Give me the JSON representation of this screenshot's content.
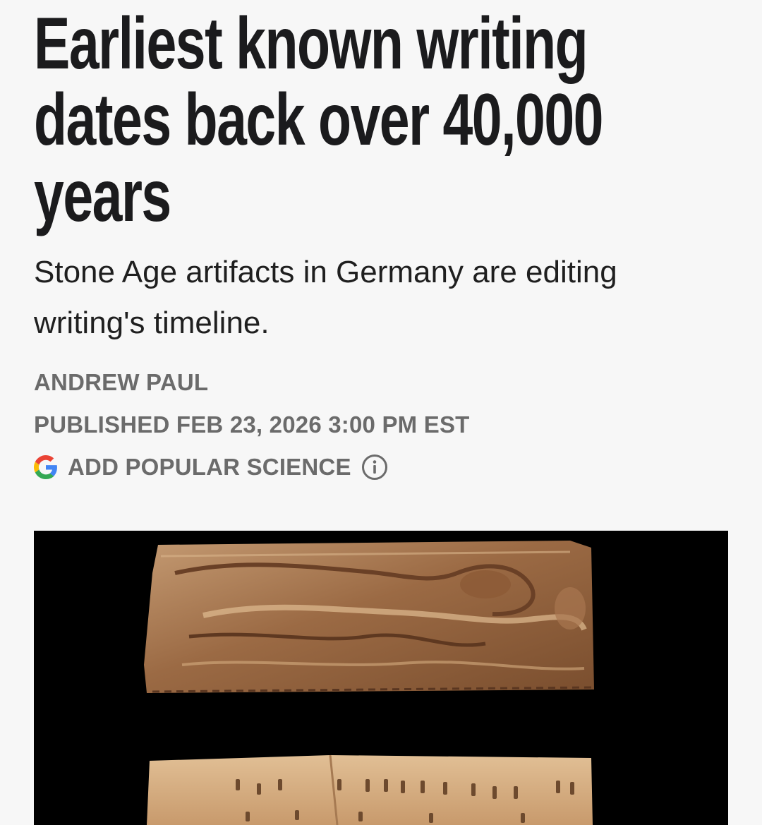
{
  "article": {
    "headline": "Earliest known writing dates back over 40,000 years",
    "dek": "Stone Age artifacts in Germany are editing writing's timeline.",
    "author": "ANDREW PAUL",
    "published": "PUBLISHED FEB 23, 2026 3:00 PM EST",
    "add_source_label": "ADD POPULAR SCIENCE"
  },
  "icons": {
    "google": "google-g-icon",
    "info": "info-circle-icon"
  },
  "colors": {
    "background": "#f7f7f7",
    "headline": "#1b1b1d",
    "meta": "#6b6b6b",
    "image_background": "#000000",
    "artifact": "#9a6a45"
  }
}
